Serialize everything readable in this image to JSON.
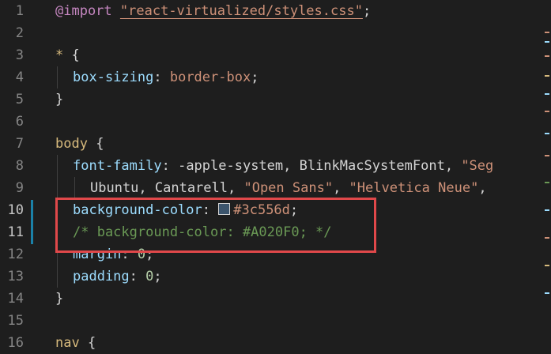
{
  "editor": {
    "line_numbers": [
      "1",
      "2",
      "3",
      "4",
      "5",
      "6",
      "7",
      "8",
      "9",
      "10",
      "11",
      "12",
      "13",
      "14",
      "15",
      "16"
    ],
    "lines": {
      "l1": {
        "kw": "@import",
        "sp": " ",
        "str": "\"react-virtualized/styles.css\"",
        "end": ";"
      },
      "l3": {
        "sel": "*",
        "brace": " {"
      },
      "l4": {
        "prop": "box-sizing",
        "colon": ": ",
        "val": "border-box",
        "end": ";"
      },
      "l5": {
        "close": "}"
      },
      "l7": {
        "sel": "body",
        "brace": " {"
      },
      "l8": {
        "prop": "font-family",
        "colon": ": ",
        "val": "-apple-system, BlinkMacSystemFont, ",
        "str": "\"Seg"
      },
      "l9": {
        "val1": "Ubuntu, Cantarell, ",
        "str1": "\"Open Sans\"",
        "sep": ", ",
        "str2": "\"Helvetica Neue\"",
        "end": ","
      },
      "l10": {
        "prop": "background-color",
        "colon": ": ",
        "val": "#3c556d",
        "end": ";"
      },
      "l11": {
        "comment": "/* background-color: #A020F0; */"
      },
      "l12": {
        "prop": "margin",
        "colon": ": ",
        "val": "0",
        "end": ";"
      },
      "l13": {
        "prop": "padding",
        "colon": ": ",
        "val": "0",
        "end": ";"
      },
      "l14": {
        "close": "}"
      },
      "l16": {
        "sel": "nav",
        "brace": " {"
      }
    },
    "colors": {
      "background": "#1e1e1e",
      "swatch": "#3c556d",
      "highlight_box": "#e0484a",
      "modified_bar": "#1b81a8"
    }
  }
}
